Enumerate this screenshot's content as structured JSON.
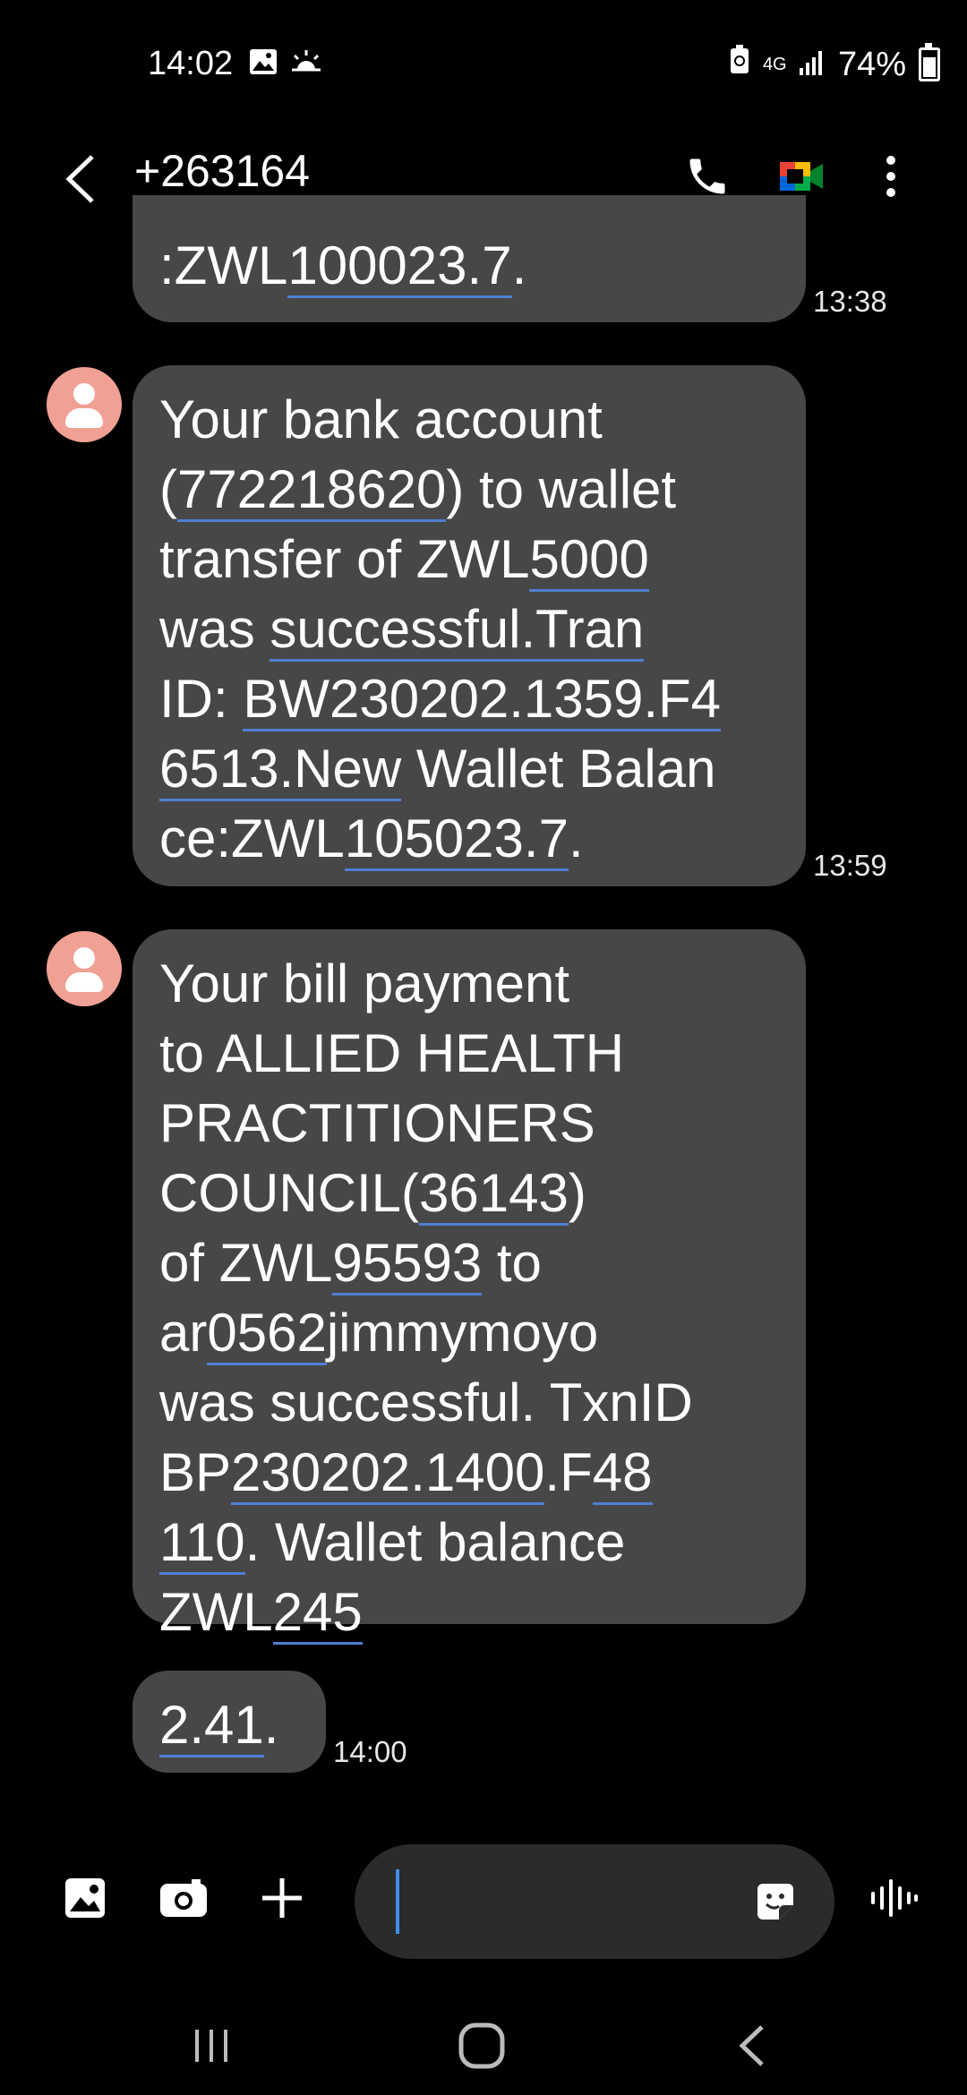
{
  "status_bar": {
    "time": "14:02",
    "network": "4G",
    "battery": "74%",
    "icons": [
      "gallery-icon",
      "weather-icon",
      "battery-saver-icon",
      "signal-icon",
      "battery-charging-icon"
    ]
  },
  "header": {
    "contact": "+263164",
    "icons": [
      "back-arrow-icon",
      "phone-icon",
      "video-call-icon",
      "more-options-icon"
    ]
  },
  "messages": [
    {
      "parts": [
        ":ZWL",
        {
          "link": "100023.7"
        },
        "."
      ],
      "time": "13:38"
    },
    {
      "parts": [
        "Your bank account\n(",
        {
          "link": "772218620"
        },
        ") to wallet\ntransfer of ZWL",
        {
          "link": "5000"
        },
        "\nwas ",
        {
          "link": "successful.Tran"
        },
        "\nID: ",
        {
          "link": "BW230202.1359.F4\n6513.New"
        },
        " Wallet Balan\nce:ZWL",
        {
          "link": "105023.7"
        },
        "."
      ],
      "time": "13:59"
    },
    {
      "parts": [
        "Your bill payment\nto ALLIED HEALTH\nPRACTITIONERS\nCOUNCIL(",
        {
          "link": "36143"
        },
        ")\nof ZWL",
        {
          "link": "95593"
        },
        " to\nar",
        {
          "link": "0562"
        },
        "jimmymoyo\nwas successful. TxnID\nBP",
        {
          "link": "230202.1400"
        },
        ".F",
        {
          "link": "48\n110"
        },
        ". Wallet balance\nZWL",
        {
          "link": "245"
        }
      ],
      "time": ""
    },
    {
      "parts": [
        {
          "link": "2.41"
        },
        "."
      ],
      "time": "14:00"
    }
  ],
  "composer": {
    "placeholder": "",
    "icons": [
      "gallery-icon",
      "camera-icon",
      "plus-icon",
      "sticker-icon",
      "voice-input-icon"
    ]
  },
  "navbar": {
    "icons": [
      "recent-apps-icon",
      "home-icon",
      "back-icon"
    ]
  },
  "colors": {
    "background": "#000000",
    "bubble": "#474747",
    "avatar": "#f1a193",
    "link_underline": "#4f7fd2",
    "caret": "#3d8ef0"
  }
}
